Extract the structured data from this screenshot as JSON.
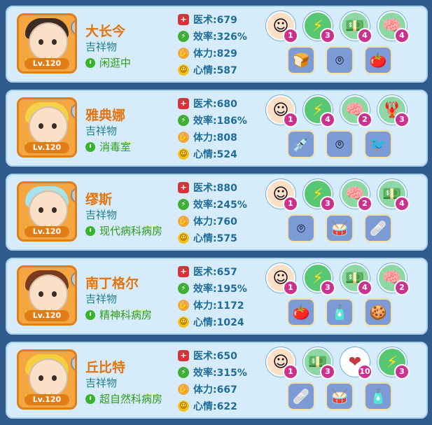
{
  "cards": [
    {
      "name": "大长今",
      "type": "吉祥物",
      "location": "闲逛中",
      "level": "Lv.120",
      "quality_badge": "全",
      "stats": {
        "med": "医术:679",
        "eff": "效率:326%",
        "str": "体力:829",
        "mood": "心情:587"
      },
      "skills": [
        {
          "icon": "avatar-icon",
          "glyph": "☺",
          "badge": "1"
        },
        {
          "icon": "lightning-icon",
          "glyph": "⚡",
          "badge": "3"
        },
        {
          "icon": "money-icon",
          "glyph": "💵",
          "badge": "4"
        },
        {
          "icon": "brain-icon",
          "glyph": "🧠",
          "badge": "4"
        }
      ],
      "items": [
        {
          "icon": "bread-icon",
          "glyph": "🍞"
        },
        {
          "icon": "bracelet-icon",
          "glyph": "⌾"
        },
        {
          "icon": "tomato-icon",
          "glyph": "🍅"
        }
      ],
      "hair_color": "#3b2b22"
    },
    {
      "name": "雅典娜",
      "type": "吉祥物",
      "location": "消毒室",
      "level": "Lv.120",
      "quality_badge": "全",
      "stats": {
        "med": "医术:680",
        "eff": "效率:186%",
        "str": "体力:808",
        "mood": "心情:524"
      },
      "skills": [
        {
          "icon": "avatar-icon",
          "glyph": "☺",
          "badge": "1"
        },
        {
          "icon": "lightning-icon",
          "glyph": "⚡",
          "badge": "4"
        },
        {
          "icon": "brain-icon",
          "glyph": "🧠",
          "badge": "2"
        },
        {
          "icon": "lobster-icon",
          "glyph": "🦞",
          "badge": "3"
        }
      ],
      "items": [
        {
          "icon": "syringe-icon",
          "glyph": "💉"
        },
        {
          "icon": "bracelet-icon",
          "glyph": "⌾"
        },
        {
          "icon": "parrot-icon",
          "glyph": "🐦"
        }
      ],
      "hair_color": "#f3d24a"
    },
    {
      "name": "缪斯",
      "type": "吉祥物",
      "location": "现代病科病房",
      "level": "Lv.120",
      "quality_badge": "全",
      "stats": {
        "med": "医术:880",
        "eff": "效率:245%",
        "str": "体力:760",
        "mood": "心情:575"
      },
      "skills": [
        {
          "icon": "avatar-icon",
          "glyph": "☺",
          "badge": "1"
        },
        {
          "icon": "lightning-icon",
          "glyph": "⚡",
          "badge": "3"
        },
        {
          "icon": "brain-icon",
          "glyph": "🧠",
          "badge": "2"
        },
        {
          "icon": "money-icon",
          "glyph": "💵",
          "badge": "4"
        }
      ],
      "items": [
        {
          "icon": "bracelet-icon",
          "glyph": "⌾"
        },
        {
          "icon": "drum-icon",
          "glyph": "🥁"
        },
        {
          "icon": "bandage-icon",
          "glyph": "🩹"
        }
      ],
      "hair_color": "#a7e2ef"
    },
    {
      "name": "南丁格尔",
      "type": "吉祥物",
      "location": "精神科病房",
      "level": "Lv.120",
      "quality_badge": "全",
      "stats": {
        "med": "医术:657",
        "eff": "效率:195%",
        "str": "体力:1172",
        "mood": "心情:1024"
      },
      "skills": [
        {
          "icon": "avatar-icon",
          "glyph": "☺",
          "badge": "1"
        },
        {
          "icon": "lightning-icon",
          "glyph": "⚡",
          "badge": "3"
        },
        {
          "icon": "money-icon",
          "glyph": "💵",
          "badge": "4"
        },
        {
          "icon": "brain-icon",
          "glyph": "🧠",
          "badge": "2"
        }
      ],
      "items": [
        {
          "icon": "tomato-icon",
          "glyph": "🍅"
        },
        {
          "icon": "bottle-icon",
          "glyph": "🧴"
        },
        {
          "icon": "gingerbread-icon",
          "glyph": "🍪"
        }
      ],
      "hair_color": "#7a3a1e"
    },
    {
      "name": "丘比特",
      "type": "吉祥物",
      "location": "超自然科病房",
      "level": "Lv.120",
      "quality_badge": "全",
      "stats": {
        "med": "医术:650",
        "eff": "效率:315%",
        "str": "体力:667",
        "mood": "心情:622"
      },
      "skills": [
        {
          "icon": "avatar-icon",
          "glyph": "☺",
          "badge": "1"
        },
        {
          "icon": "money-icon",
          "glyph": "💵",
          "badge": "3"
        },
        {
          "icon": "wood-icon",
          "glyph": "❤",
          "badge": "10"
        },
        {
          "icon": "lightning-icon",
          "glyph": "⚡",
          "badge": "3"
        }
      ],
      "items": [
        {
          "icon": "bandage-icon",
          "glyph": "🩹"
        },
        {
          "icon": "drum-icon",
          "glyph": "🥁"
        },
        {
          "icon": "bottle-icon",
          "glyph": "🧴"
        }
      ],
      "hair_color": "#f5cf3d"
    }
  ]
}
